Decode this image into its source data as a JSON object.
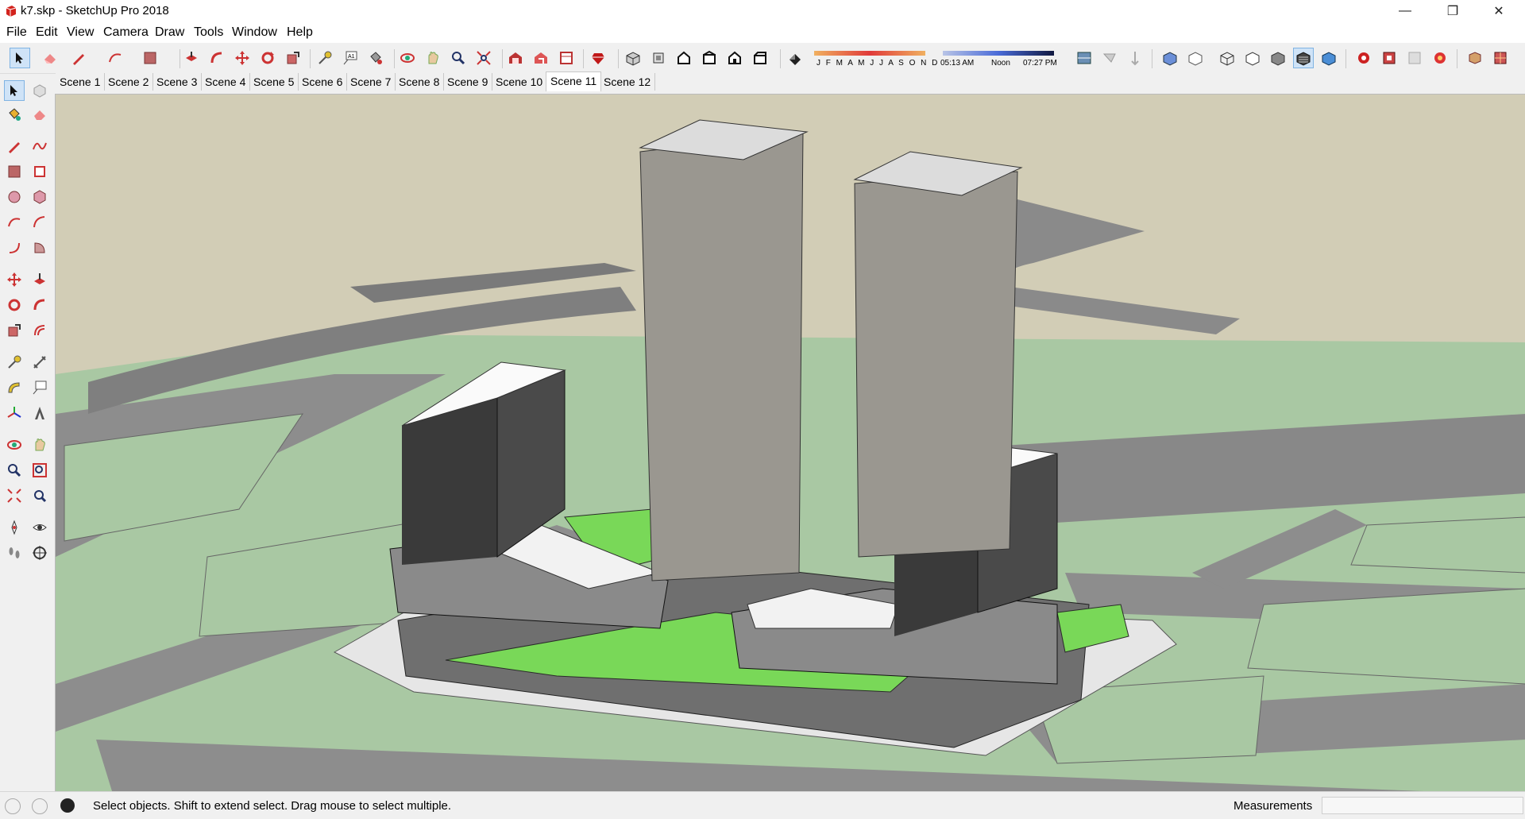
{
  "window": {
    "title": "k7.skp - SketchUp Pro 2018",
    "minimize": "—",
    "restore": "❐",
    "close": "✕"
  },
  "menu": [
    "File",
    "Edit",
    "View",
    "Camera",
    "Draw",
    "Tools",
    "Window",
    "Help"
  ],
  "shadow": {
    "months": "J F M A M J J A S O N D",
    "time_start": "05:13 AM",
    "time_mid": "Noon",
    "time_end": "07:27 PM"
  },
  "scenes": [
    "Scene 1",
    "Scene 2",
    "Scene 3",
    "Scene 4",
    "Scene 5",
    "Scene 6",
    "Scene 7",
    "Scene 8",
    "Scene 9",
    "Scene 10",
    "Scene 11",
    "Scene 12"
  ],
  "active_scene": "Scene 11",
  "status": {
    "message": "Select objects. Shift to extend select. Drag mouse to select multiple.",
    "measurements_label": "Measurements",
    "measurements_value": ""
  },
  "colors": {
    "sky": "#d2cdb6",
    "grass": "#a9c8a3",
    "road": "#8d8d8d",
    "green_roof": "#79d858",
    "accent_red": "#c83a2a"
  },
  "toolbar_icons": [
    "select-icon",
    "eraser-icon",
    "pencil-icon",
    "arc-icon",
    "rectangle-icon",
    "push-pull-icon",
    "follow-me-icon",
    "move-icon",
    "rotate-icon",
    "scale-icon",
    "tape-measure-icon",
    "text-icon",
    "paint-bucket-icon",
    "orbit-icon",
    "pan-icon",
    "zoom-icon",
    "zoom-extents-icon",
    "warehouse-icon",
    "extension-warehouse-icon",
    "layout-icon",
    "ruby-icon",
    "iso-view-icon",
    "top-view-icon",
    "front-view-icon",
    "right-view-icon",
    "back-view-icon",
    "left-view-icon",
    "shadows-icon"
  ]
}
